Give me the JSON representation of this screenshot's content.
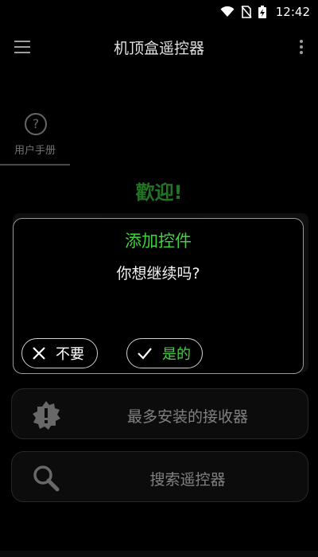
{
  "status_bar": {
    "time": "12:42",
    "icons": [
      "wifi-icon",
      "sim-icon",
      "battery-charging-icon"
    ]
  },
  "app_bar": {
    "title": "机顶盒遥控器",
    "menu_icon": "hamburger-menu-icon",
    "more_icon": "more-vert-icon"
  },
  "tabs": [
    {
      "icon": "help-circle-icon",
      "label": "用户手册"
    }
  ],
  "welcome": "歡迎!",
  "actions": [
    {
      "icon": "alert-badge-icon",
      "label": "最多安装的接收器"
    },
    {
      "icon": "search-icon",
      "label": "搜索遥控器"
    }
  ],
  "dialog": {
    "title": "添加控件",
    "message": "你想继续吗?",
    "negative_label": "不要",
    "positive_label": "是的"
  },
  "colors": {
    "accent_green": "#3fd23f",
    "background": "#000000"
  }
}
